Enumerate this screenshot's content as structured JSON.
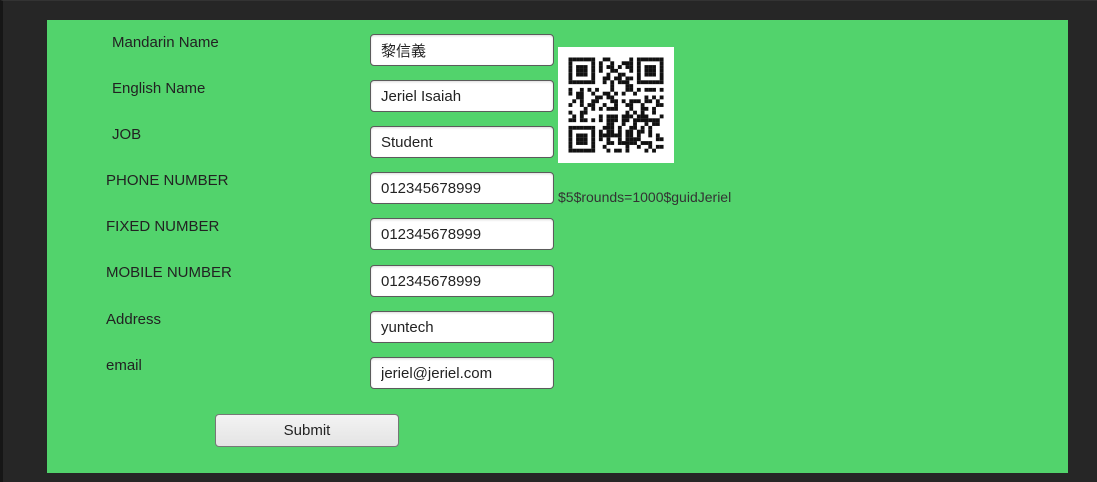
{
  "form": {
    "fields": [
      {
        "label": "Mandarin Name",
        "value": "黎信義"
      },
      {
        "label": "English Name",
        "value": "Jeriel Isaiah"
      },
      {
        "label": "JOB",
        "value": "Student"
      },
      {
        "label": "PHONE NUMBER",
        "value": "012345678999"
      },
      {
        "label": "FIXED NUMBER",
        "value": "012345678999"
      },
      {
        "label": "MOBILE NUMBER",
        "value": "012345678999"
      },
      {
        "label": "Address",
        "value": "yuntech"
      },
      {
        "label": "email",
        "value": "jeriel@jeriel.com"
      }
    ],
    "submit_label": "Submit"
  },
  "qr": {
    "icon": "qr-code",
    "hash_text": "$5$rounds=1000$guidJeriel"
  },
  "colors": {
    "panel_background": "#52d36c",
    "window_background": "#262626"
  }
}
